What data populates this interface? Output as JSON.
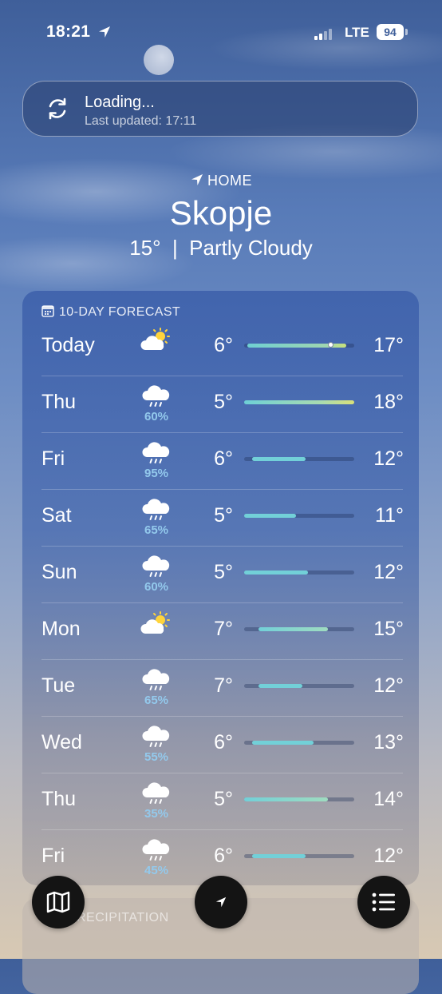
{
  "status_bar": {
    "time": "18:21",
    "network": "LTE",
    "battery": "94"
  },
  "banner": {
    "title": "Loading...",
    "subtitle": "Last updated: 17:11"
  },
  "location": {
    "label": "HOME",
    "city": "Skopje",
    "summary": "15°  |  Partly Cloudy"
  },
  "forecast": {
    "header": "10-DAY FORECAST",
    "days": [
      {
        "day": "Today",
        "icon": "partly-cloudy-sun-icon",
        "precip": "",
        "low": "6°",
        "high": "17°",
        "bar_start": 0.03,
        "bar_end": 0.93,
        "current_pos": 0.78,
        "bar_color": "linear-gradient(90deg,#6fd0d2,#9fd6b0 80%,#c9e27a)"
      },
      {
        "day": "Thu",
        "icon": "rain-cloud-icon",
        "precip": "60%",
        "low": "5°",
        "high": "18°",
        "bar_start": 0.0,
        "bar_end": 1.0,
        "current_pos": null,
        "bar_color": "linear-gradient(90deg,#6ed0d6,#a9dbb0 70%,#d9e07a)"
      },
      {
        "day": "Fri",
        "icon": "rain-cloud-icon",
        "precip": "95%",
        "low": "6°",
        "high": "12°",
        "bar_start": 0.07,
        "bar_end": 0.56,
        "current_pos": null,
        "bar_color": "#72d0d8"
      },
      {
        "day": "Sat",
        "icon": "rain-cloud-icon",
        "precip": "65%",
        "low": "5°",
        "high": "11°",
        "bar_start": 0.0,
        "bar_end": 0.47,
        "current_pos": null,
        "bar_color": "#72d0d8"
      },
      {
        "day": "Sun",
        "icon": "rain-cloud-icon",
        "precip": "60%",
        "low": "5°",
        "high": "12°",
        "bar_start": 0.0,
        "bar_end": 0.58,
        "current_pos": null,
        "bar_color": "#72d0d8"
      },
      {
        "day": "Mon",
        "icon": "partly-cloudy-sun-icon",
        "precip": "",
        "low": "7°",
        "high": "15°",
        "bar_start": 0.13,
        "bar_end": 0.76,
        "current_pos": null,
        "bar_color": "linear-gradient(90deg,#72d0d8,#9fdcc0)"
      },
      {
        "day": "Tue",
        "icon": "rain-cloud-icon",
        "precip": "65%",
        "low": "7°",
        "high": "12°",
        "bar_start": 0.13,
        "bar_end": 0.53,
        "current_pos": null,
        "bar_color": "#72d0d8"
      },
      {
        "day": "Wed",
        "icon": "rain-cloud-icon",
        "precip": "55%",
        "low": "6°",
        "high": "13°",
        "bar_start": 0.07,
        "bar_end": 0.63,
        "current_pos": null,
        "bar_color": "#72d0d8"
      },
      {
        "day": "Thu",
        "icon": "rain-cloud-icon",
        "precip": "35%",
        "low": "5°",
        "high": "14°",
        "bar_start": 0.0,
        "bar_end": 0.76,
        "current_pos": null,
        "bar_color": "linear-gradient(90deg,#72d0d8,#9fdcc0)"
      },
      {
        "day": "Fri",
        "icon": "rain-cloud-icon",
        "precip": "45%",
        "low": "6°",
        "high": "12°",
        "bar_start": 0.07,
        "bar_end": 0.56,
        "current_pos": null,
        "bar_color": "#72d0d8"
      }
    ]
  },
  "next_section": {
    "label": "RECIPITATION"
  },
  "buttons": {
    "map": "map-icon",
    "location": "location-arrow-icon",
    "list": "list-icon"
  }
}
